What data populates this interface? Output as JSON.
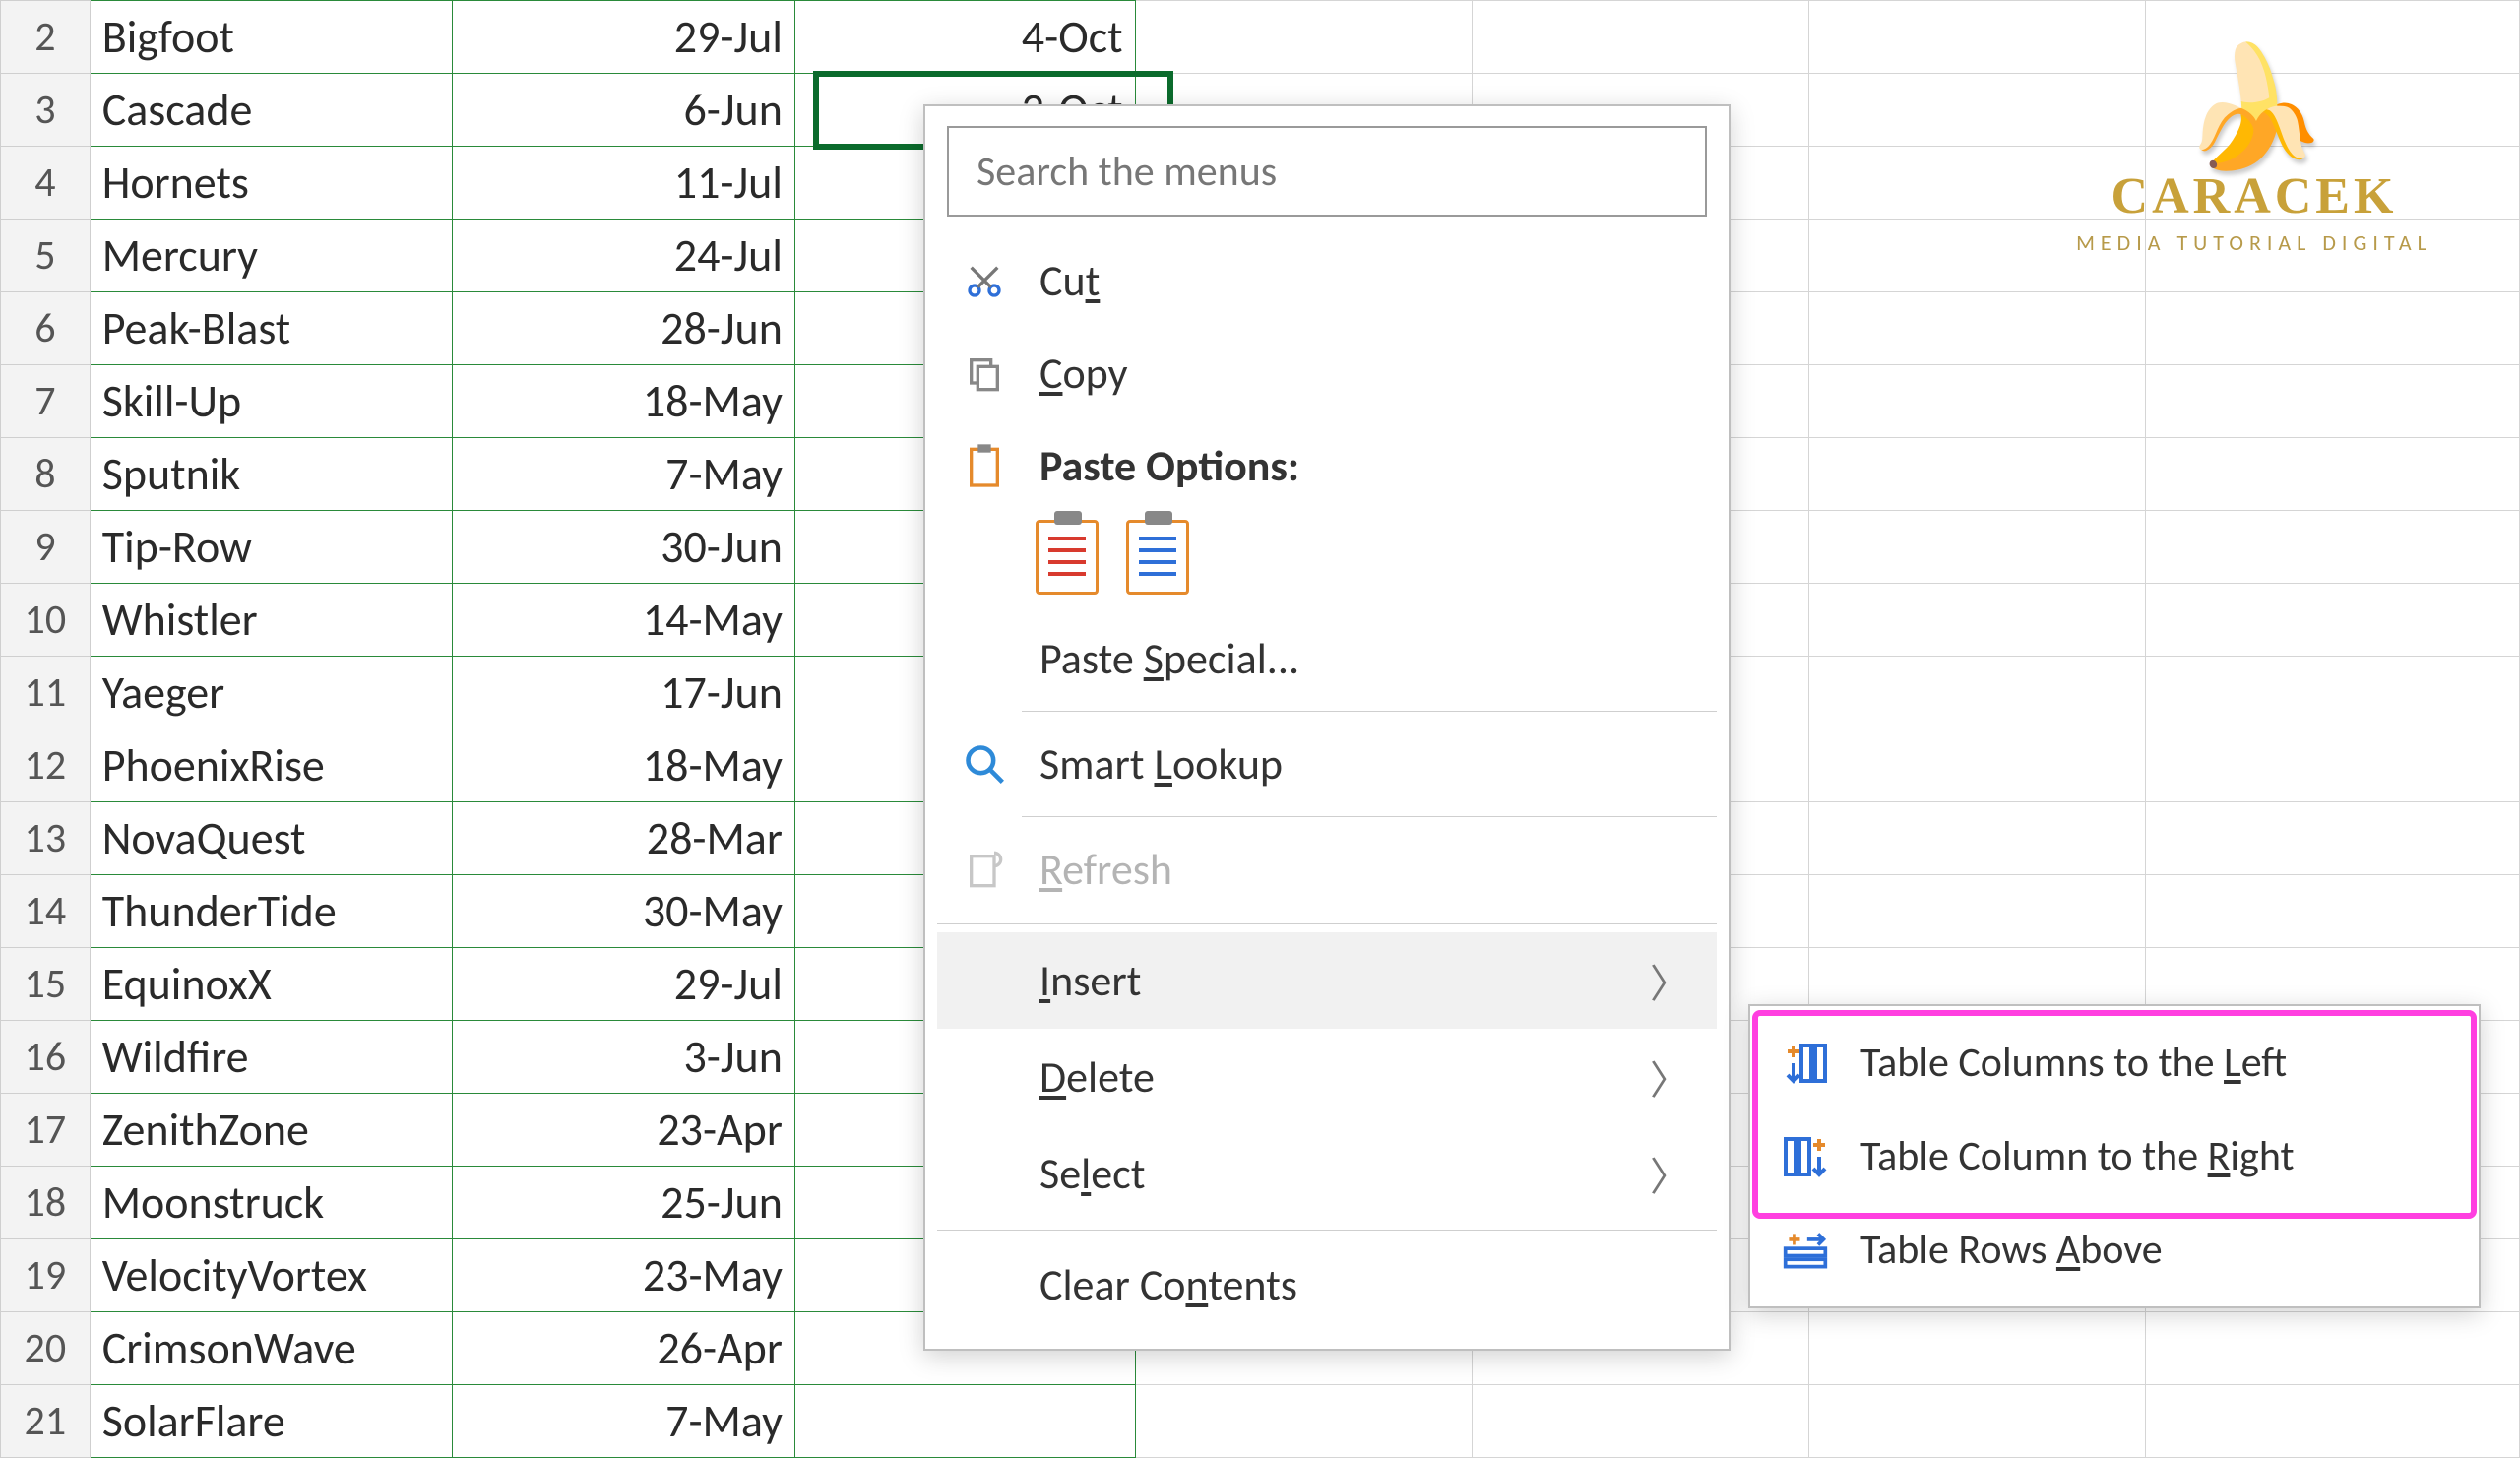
{
  "rows": [
    {
      "num": "2",
      "name": "Bigfoot",
      "d1": "29-Jul",
      "d2": "4-Oct"
    },
    {
      "num": "3",
      "name": "Cascade",
      "d1": "6-Jun",
      "d2": "2-Oct"
    },
    {
      "num": "4",
      "name": "Hornets",
      "d1": "11-Jul",
      "d2": ""
    },
    {
      "num": "5",
      "name": "Mercury",
      "d1": "24-Jul",
      "d2": ""
    },
    {
      "num": "6",
      "name": "Peak-Blast",
      "d1": "28-Jun",
      "d2": ""
    },
    {
      "num": "7",
      "name": "Skill-Up",
      "d1": "18-May",
      "d2": ""
    },
    {
      "num": "8",
      "name": "Sputnik",
      "d1": "7-May",
      "d2": ""
    },
    {
      "num": "9",
      "name": "Tip-Row",
      "d1": "30-Jun",
      "d2": ""
    },
    {
      "num": "10",
      "name": "Whistler",
      "d1": "14-May",
      "d2": ""
    },
    {
      "num": "11",
      "name": "Yaeger",
      "d1": "17-Jun",
      "d2": ""
    },
    {
      "num": "12",
      "name": "PhoenixRise",
      "d1": "18-May",
      "d2": ""
    },
    {
      "num": "13",
      "name": "NovaQuest",
      "d1": "28-Mar",
      "d2": ""
    },
    {
      "num": "14",
      "name": "ThunderTide",
      "d1": "30-May",
      "d2": ""
    },
    {
      "num": "15",
      "name": "EquinoxX",
      "d1": "29-Jul",
      "d2": ""
    },
    {
      "num": "16",
      "name": "Wildfire",
      "d1": "3-Jun",
      "d2": ""
    },
    {
      "num": "17",
      "name": "ZenithZone",
      "d1": "23-Apr",
      "d2": ""
    },
    {
      "num": "18",
      "name": "Moonstruck",
      "d1": "25-Jun",
      "d2": ""
    },
    {
      "num": "19",
      "name": "VelocityVortex",
      "d1": "23-May",
      "d2": ""
    },
    {
      "num": "20",
      "name": "CrimsonWave",
      "d1": "26-Apr",
      "d2": ""
    },
    {
      "num": "21",
      "name": "SolarFlare",
      "d1": "7-May",
      "d2": ""
    }
  ],
  "ctx": {
    "search_placeholder": "Search the menus",
    "cut": "Cut",
    "copy": "Copy",
    "paste_options": "Paste Options:",
    "paste_special": "Paste Special...",
    "smart_lookup": "Smart Lookup",
    "refresh": "Refresh",
    "insert": "Insert",
    "delete": "Delete",
    "select": "Select",
    "clear_contents": "Clear Contents"
  },
  "submenu": {
    "cols_left": "Table Columns to the Left",
    "col_right": "Table Column to the Right",
    "rows_above": "Table Rows Above"
  },
  "brand": {
    "title": "CARACEK",
    "sub": "MEDIA TUTORIAL DIGITAL"
  }
}
